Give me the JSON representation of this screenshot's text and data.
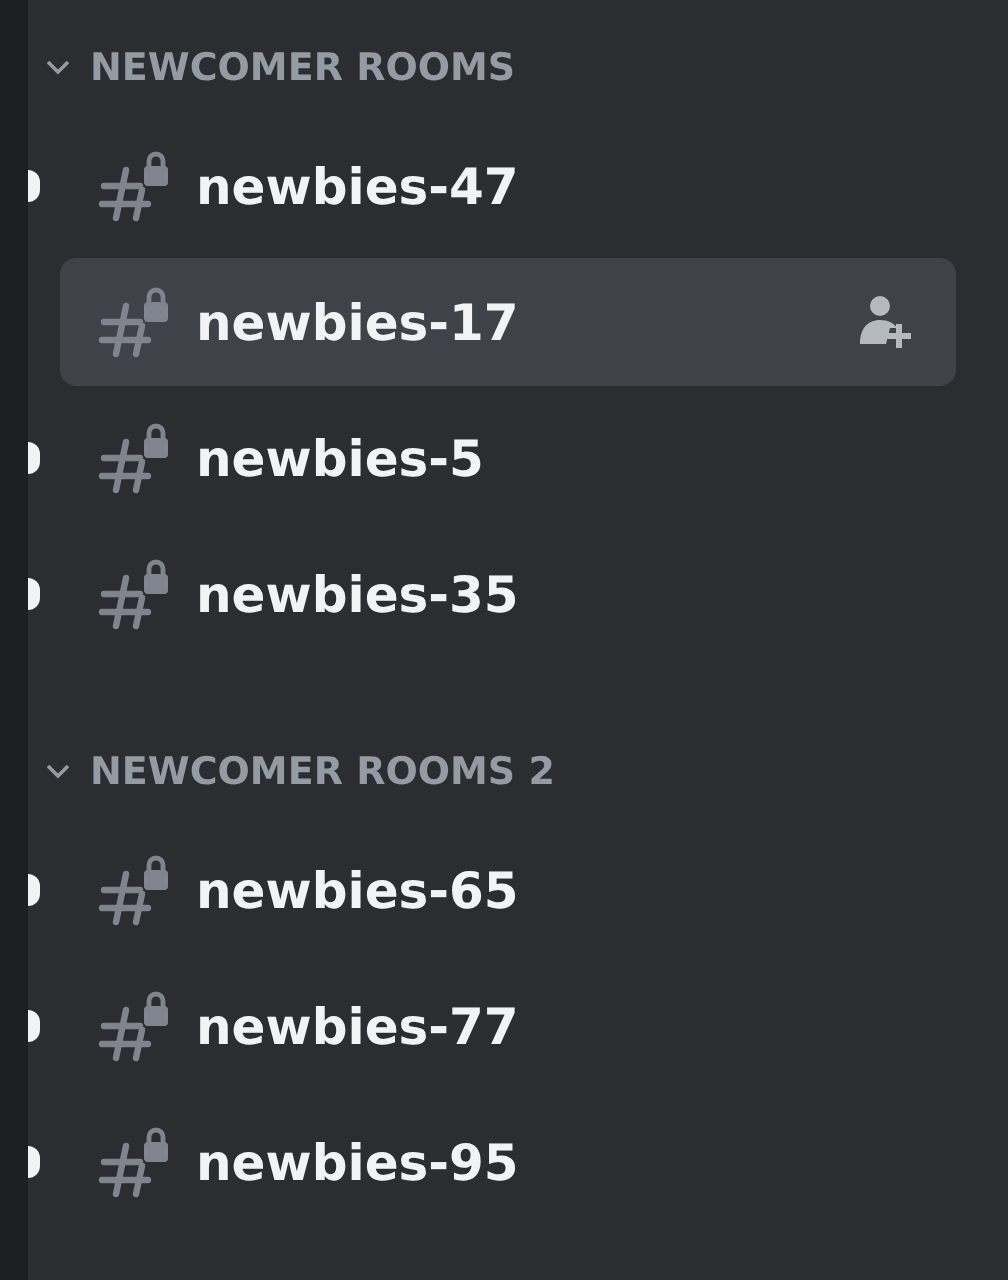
{
  "categories": [
    {
      "name": "NEWCOMER ROOMS",
      "expanded": true,
      "channels": [
        {
          "name": "newbies-47",
          "unread": true,
          "selected": false
        },
        {
          "name": "newbies-17",
          "unread": false,
          "selected": true
        },
        {
          "name": "newbies-5",
          "unread": true,
          "selected": false
        },
        {
          "name": "newbies-35",
          "unread": true,
          "selected": false
        }
      ]
    },
    {
      "name": "NEWCOMER ROOMS 2",
      "expanded": true,
      "channels": [
        {
          "name": "newbies-65",
          "unread": true,
          "selected": false
        },
        {
          "name": "newbies-77",
          "unread": true,
          "selected": false
        },
        {
          "name": "newbies-95",
          "unread": true,
          "selected": false
        }
      ]
    }
  ]
}
